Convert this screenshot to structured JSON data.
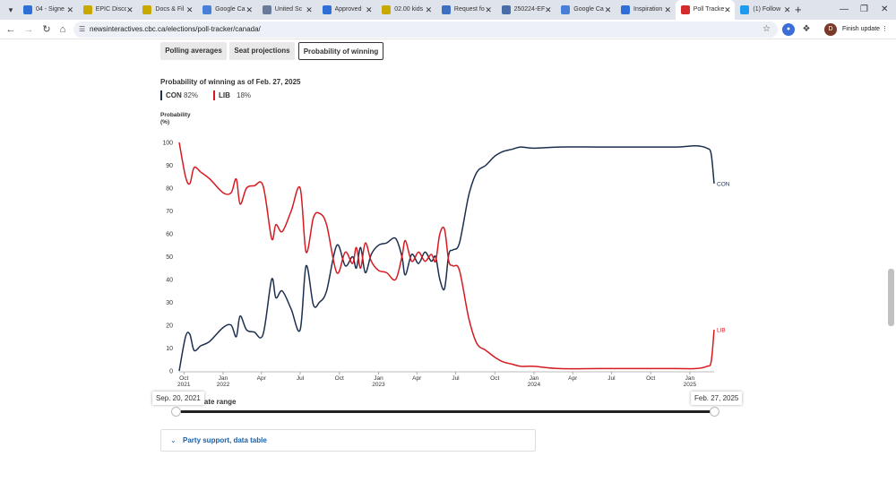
{
  "browser": {
    "tabs": [
      {
        "title": "04 - Signe",
        "color": "#2f6fd6"
      },
      {
        "title": "EPIC Disco",
        "color": "#c9a800"
      },
      {
        "title": "Docs & Fil",
        "color": "#c9a800"
      },
      {
        "title": "Google Ca",
        "color": "#4a7fd8"
      },
      {
        "title": "United Sc",
        "color": "#6a7a99"
      },
      {
        "title": "Approved",
        "color": "#2f6fd6"
      },
      {
        "title": "02.00 kids",
        "color": "#c9a800"
      },
      {
        "title": "Request fo",
        "color": "#3d6fc2"
      },
      {
        "title": "250224-EF",
        "color": "#4a6fa8"
      },
      {
        "title": "Google Ca",
        "color": "#4a7fd8"
      },
      {
        "title": "Inspiration",
        "color": "#2f6fd6"
      },
      {
        "title": "Poll Tracke",
        "color": "#d62b2b"
      },
      {
        "title": "(1) Follow",
        "color": "#1d9bf0"
      }
    ],
    "active_tab_index": 11,
    "url": "newsinteractives.cbc.ca/elections/poll-tracker/canada/",
    "finish_update_label": "Finish update",
    "profile_initial": "D"
  },
  "page": {
    "tabs": [
      {
        "label": "Polling averages",
        "active": false
      },
      {
        "label": "Seat projections",
        "active": false
      },
      {
        "label": "Probability of winning",
        "active": true
      }
    ],
    "title": "Probability of winning as of Feb. 27, 2025",
    "legend": [
      {
        "party": "CON",
        "value": "82%",
        "color": "#1b2f4f"
      },
      {
        "party": "LIB",
        "value": "18%",
        "color": "#d71920"
      }
    ],
    "ylabel_line1": "Probability",
    "ylabel_line2": "(%)",
    "range_label": "date range",
    "range_start": "Sep. 20, 2021",
    "range_end": "Feb. 27, 2025",
    "accordion_label": "Party support, data table"
  },
  "chart_data": {
    "type": "line",
    "title": "Probability of winning as of Feb. 27, 2025",
    "ylabel": "Probability (%)",
    "ylim": [
      0,
      100
    ],
    "yticks": [
      0,
      10,
      20,
      30,
      40,
      50,
      60,
      70,
      80,
      90,
      100
    ],
    "grid": false,
    "legend": "top-left",
    "x_ticks": [
      {
        "label": "Oct",
        "sub": "2021",
        "date": "2021-10-01"
      },
      {
        "label": "Jan",
        "sub": "2022",
        "date": "2022-01-01"
      },
      {
        "label": "Apr",
        "sub": "",
        "date": "2022-04-01"
      },
      {
        "label": "Jul",
        "sub": "",
        "date": "2022-07-01"
      },
      {
        "label": "Oct",
        "sub": "",
        "date": "2022-10-01"
      },
      {
        "label": "Jan",
        "sub": "2023",
        "date": "2023-01-01"
      },
      {
        "label": "Apr",
        "sub": "",
        "date": "2023-04-01"
      },
      {
        "label": "Jul",
        "sub": "",
        "date": "2023-07-01"
      },
      {
        "label": "Oct",
        "sub": "",
        "date": "2023-10-01"
      },
      {
        "label": "Jan",
        "sub": "2024",
        "date": "2024-01-01"
      },
      {
        "label": "Apr",
        "sub": "",
        "date": "2024-04-01"
      },
      {
        "label": "Jul",
        "sub": "",
        "date": "2024-07-01"
      },
      {
        "label": "Oct",
        "sub": "",
        "date": "2024-10-01"
      },
      {
        "label": "Jan",
        "sub": "2025",
        "date": "2025-01-01"
      }
    ],
    "x_range": [
      "2021-09-20",
      "2025-02-27"
    ],
    "series": [
      {
        "name": "CON",
        "color": "#1b2f4f",
        "end_label": "CON",
        "points": [
          [
            "2021-09-20",
            0
          ],
          [
            "2021-10-05",
            15
          ],
          [
            "2021-10-15",
            16
          ],
          [
            "2021-10-25",
            9
          ],
          [
            "2021-11-10",
            11
          ],
          [
            "2021-12-01",
            13
          ],
          [
            "2022-01-01",
            19
          ],
          [
            "2022-01-20",
            20
          ],
          [
            "2022-02-01",
            15
          ],
          [
            "2022-02-10",
            24
          ],
          [
            "2022-02-25",
            18
          ],
          [
            "2022-03-15",
            17
          ],
          [
            "2022-04-05",
            16
          ],
          [
            "2022-04-25",
            40
          ],
          [
            "2022-05-05",
            32
          ],
          [
            "2022-05-20",
            35
          ],
          [
            "2022-06-10",
            27
          ],
          [
            "2022-07-01",
            18
          ],
          [
            "2022-07-15",
            46
          ],
          [
            "2022-08-01",
            29
          ],
          [
            "2022-08-15",
            30
          ],
          [
            "2022-09-01",
            35
          ],
          [
            "2022-09-25",
            55
          ],
          [
            "2022-10-15",
            46
          ],
          [
            "2022-11-01",
            50
          ],
          [
            "2022-11-10",
            45
          ],
          [
            "2022-11-20",
            54
          ],
          [
            "2022-12-01",
            43
          ],
          [
            "2022-12-15",
            51
          ],
          [
            "2023-01-01",
            55
          ],
          [
            "2023-01-20",
            56
          ],
          [
            "2023-02-10",
            58
          ],
          [
            "2023-02-25",
            50
          ],
          [
            "2023-03-05",
            42
          ],
          [
            "2023-03-20",
            51
          ],
          [
            "2023-04-05",
            47
          ],
          [
            "2023-04-20",
            52
          ],
          [
            "2023-05-05",
            48
          ],
          [
            "2023-05-15",
            50
          ],
          [
            "2023-05-25",
            40
          ],
          [
            "2023-06-05",
            36
          ],
          [
            "2023-06-15",
            51
          ],
          [
            "2023-06-25",
            53
          ],
          [
            "2023-07-10",
            56
          ],
          [
            "2023-08-01",
            77
          ],
          [
            "2023-08-20",
            87
          ],
          [
            "2023-09-10",
            90
          ],
          [
            "2023-10-01",
            94
          ],
          [
            "2023-10-20",
            96
          ],
          [
            "2023-11-10",
            97
          ],
          [
            "2023-12-01",
            98
          ],
          [
            "2024-01-01",
            97.5
          ],
          [
            "2024-03-01",
            98
          ],
          [
            "2024-06-01",
            98
          ],
          [
            "2024-09-01",
            98
          ],
          [
            "2024-12-01",
            98
          ],
          [
            "2025-01-15",
            98.5
          ],
          [
            "2025-02-10",
            97.5
          ],
          [
            "2025-02-20",
            95
          ],
          [
            "2025-02-27",
            82
          ]
        ]
      },
      {
        "name": "LIB",
        "color": "#d71920",
        "end_label": "LIB",
        "points": [
          [
            "2021-09-20",
            100
          ],
          [
            "2021-10-05",
            85
          ],
          [
            "2021-10-15",
            82
          ],
          [
            "2021-10-25",
            89
          ],
          [
            "2021-11-10",
            87
          ],
          [
            "2021-12-01",
            84
          ],
          [
            "2022-01-01",
            78
          ],
          [
            "2022-01-20",
            78
          ],
          [
            "2022-02-01",
            84
          ],
          [
            "2022-02-10",
            73
          ],
          [
            "2022-02-25",
            80
          ],
          [
            "2022-03-15",
            81
          ],
          [
            "2022-04-05",
            81
          ],
          [
            "2022-04-25",
            58
          ],
          [
            "2022-05-05",
            64
          ],
          [
            "2022-05-20",
            61
          ],
          [
            "2022-06-10",
            70
          ],
          [
            "2022-07-01",
            80
          ],
          [
            "2022-07-15",
            52
          ],
          [
            "2022-08-01",
            67
          ],
          [
            "2022-08-15",
            69
          ],
          [
            "2022-09-01",
            64
          ],
          [
            "2022-09-25",
            43
          ],
          [
            "2022-10-15",
            52
          ],
          [
            "2022-11-01",
            47
          ],
          [
            "2022-11-10",
            54
          ],
          [
            "2022-11-20",
            45
          ],
          [
            "2022-12-01",
            56
          ],
          [
            "2022-12-15",
            48
          ],
          [
            "2023-01-01",
            44
          ],
          [
            "2023-01-20",
            43
          ],
          [
            "2023-02-10",
            40
          ],
          [
            "2023-02-25",
            50
          ],
          [
            "2023-03-05",
            57
          ],
          [
            "2023-03-20",
            48
          ],
          [
            "2023-04-05",
            52
          ],
          [
            "2023-04-20",
            48
          ],
          [
            "2023-05-05",
            51
          ],
          [
            "2023-05-15",
            48
          ],
          [
            "2023-05-25",
            60
          ],
          [
            "2023-06-05",
            62
          ],
          [
            "2023-06-15",
            48
          ],
          [
            "2023-06-25",
            46
          ],
          [
            "2023-07-10",
            44
          ],
          [
            "2023-08-01",
            23
          ],
          [
            "2023-08-20",
            12
          ],
          [
            "2023-09-10",
            9
          ],
          [
            "2023-10-01",
            6
          ],
          [
            "2023-10-20",
            4
          ],
          [
            "2023-11-10",
            3
          ],
          [
            "2023-12-01",
            2
          ],
          [
            "2024-01-01",
            2
          ],
          [
            "2024-03-01",
            1
          ],
          [
            "2024-06-01",
            1
          ],
          [
            "2024-09-01",
            1
          ],
          [
            "2024-12-01",
            1
          ],
          [
            "2025-01-15",
            1
          ],
          [
            "2025-02-10",
            2
          ],
          [
            "2025-02-20",
            4
          ],
          [
            "2025-02-27",
            18
          ]
        ]
      }
    ]
  }
}
